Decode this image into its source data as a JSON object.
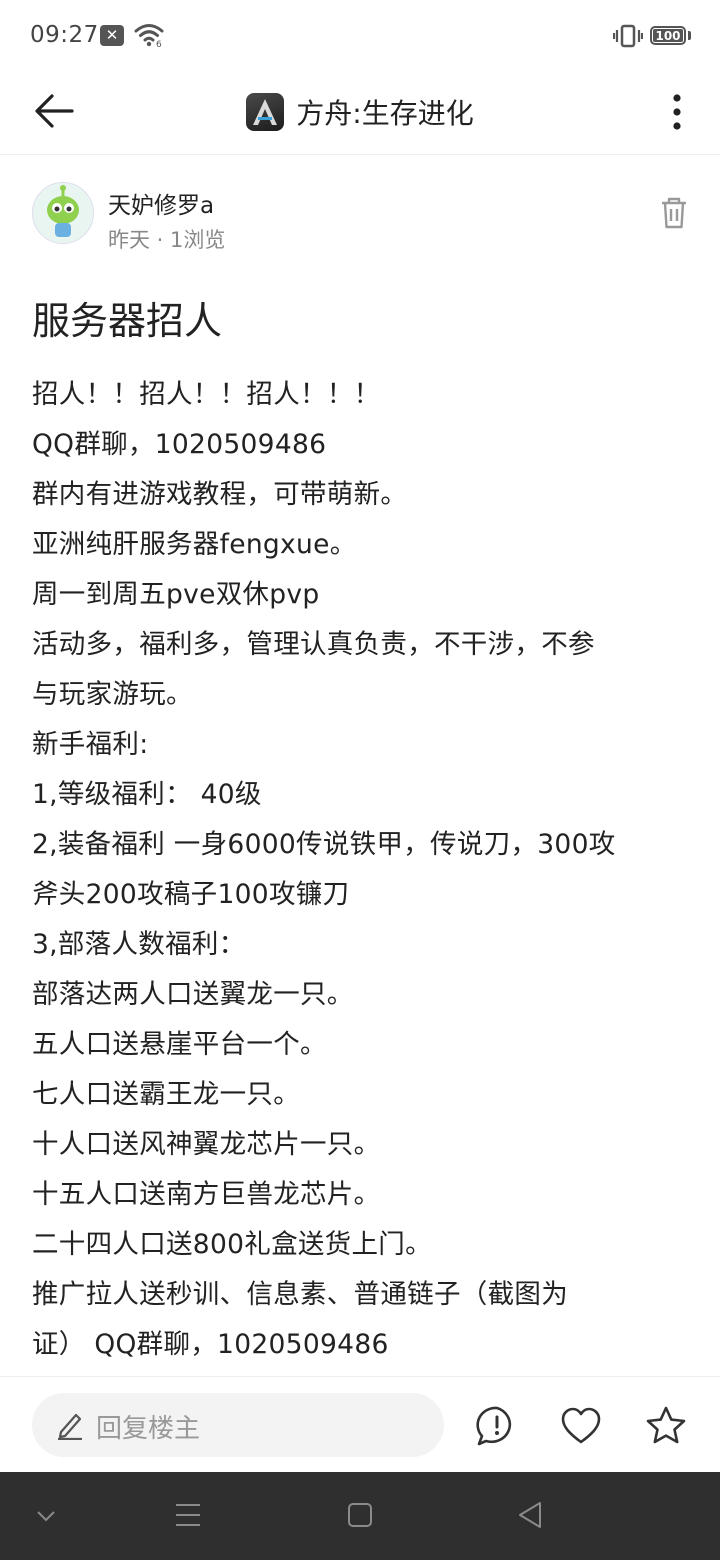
{
  "status_bar": {
    "time": "09:27",
    "notification_icon": "close-x-icon",
    "battery": "100"
  },
  "header": {
    "title": "方舟:生存进化",
    "app_icon_letter": "A"
  },
  "author": {
    "name": "天妒修罗a",
    "meta": "昨天 · 1浏览"
  },
  "post": {
    "title": "服务器招人",
    "lines": [
      "招人！！招人！！招人！！！",
      "QQ群聊，1020509486",
      "群内有进游戏教程，可带萌新。",
      "亚洲纯肝服务器fengxue。",
      "周一到周五pve双休pvp",
      "活动多，福利多，管理认真负责，不干涉，不参",
      "与玩家游玩。",
      "新手福利:",
      "1,等级福利：  40级",
      "2,装备福利 一身6000传说铁甲，传说刀，300攻",
      "斧头200攻稿子100攻镰刀",
      "3,部落人数福利：",
      "部落达两人口送翼龙一只。",
      "五人口送悬崖平台一个。",
      "七人口送霸王龙一只。",
      "十人口送风神翼龙芯片一只。",
      "十五人口送南方巨兽龙芯片。",
      "二十四人口送800礼盒送货上门。",
      "推广拉人送秒训、信息素、普通链子（截图为",
      "证） QQ群聊，1020509486"
    ]
  },
  "reply_bar": {
    "placeholder": "回复楼主"
  },
  "colors": {
    "text": "#222222",
    "meta": "#888888",
    "nav_bar": "#2f2f2f"
  }
}
